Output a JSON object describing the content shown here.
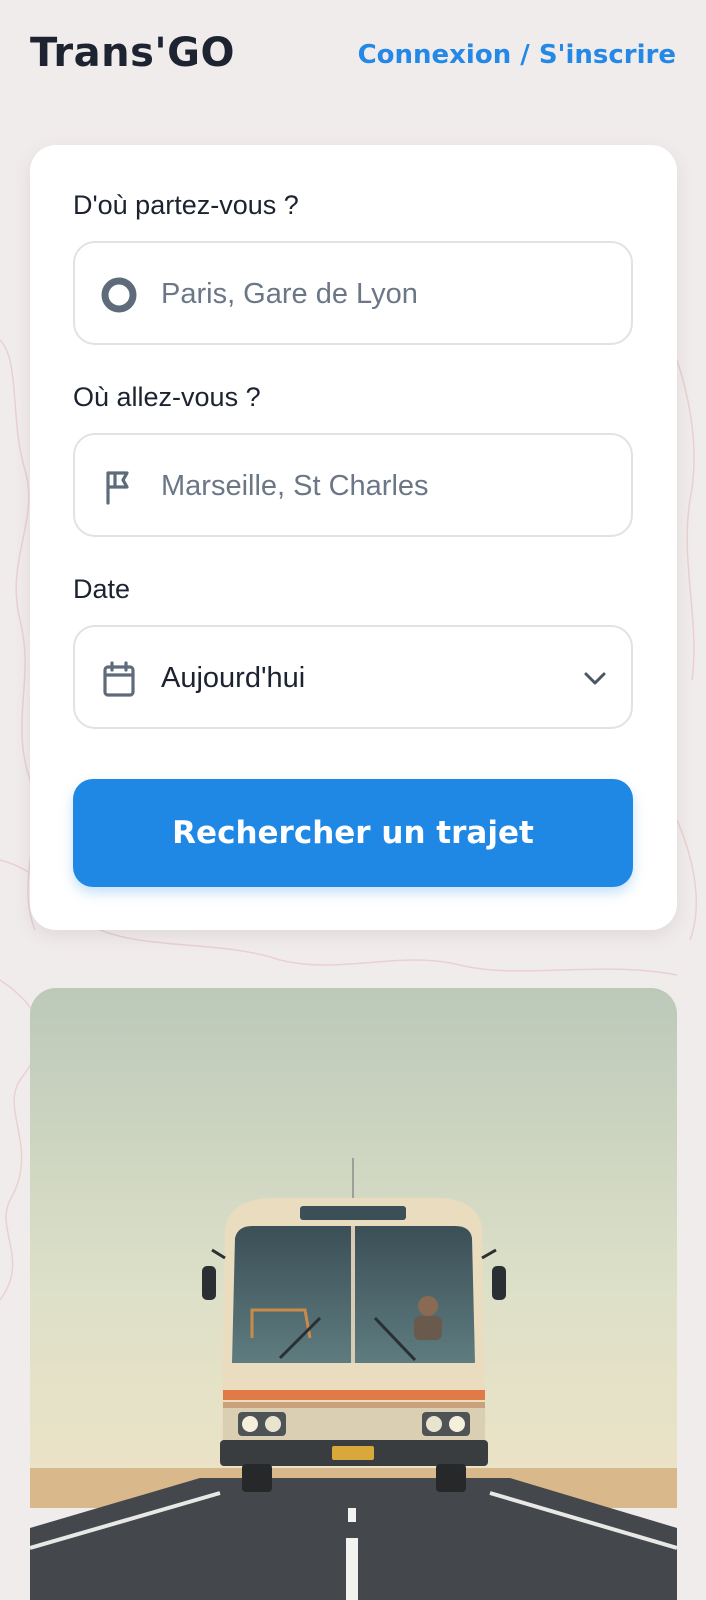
{
  "app": {
    "logo": "Trans'GO",
    "auth_link": "Connexion / S'inscrire"
  },
  "search_form": {
    "from": {
      "label": "D'où partez-vous ?",
      "placeholder": "Paris, Gare de Lyon",
      "icon": "origin-circle-icon"
    },
    "to": {
      "label": "Où allez-vous ?",
      "placeholder": "Marseille, St Charles",
      "icon": "flag-icon"
    },
    "date": {
      "label": "Date",
      "value": "Aujourd'hui",
      "icon": "calendar-icon",
      "dropdown_icon": "chevron-down-icon"
    },
    "submit_label": "Rechercher un trajet"
  },
  "hero": {
    "image": "bus-on-road-illustration"
  },
  "colors": {
    "accent": "#1f87e4",
    "link": "#2388e6",
    "background": "#f1ecec",
    "text": "#1c2230"
  }
}
